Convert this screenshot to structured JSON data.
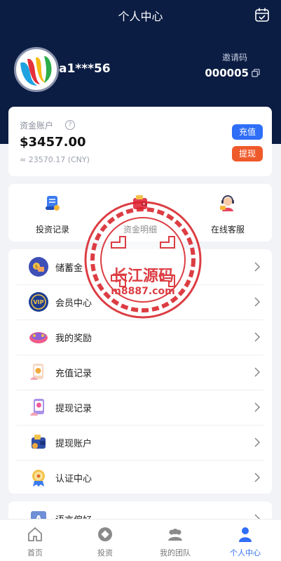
{
  "header": {
    "title": "个人中心"
  },
  "profile": {
    "username": "a1***56",
    "invite_label": "邀请码",
    "invite_code": "000005"
  },
  "account": {
    "label": "资金账户",
    "amount": "$3457.00",
    "cny": "≈ 23570.17 (CNY)",
    "recharge": "充值",
    "withdraw": "提现"
  },
  "quick": [
    {
      "label": "投资记录",
      "icon": "scroll-icon"
    },
    {
      "label": "资金明细",
      "icon": "wallet-icon"
    },
    {
      "label": "在线客服",
      "icon": "support-agent-icon"
    }
  ],
  "menu": [
    {
      "label": "储蓄金",
      "icon": "savings-icon"
    },
    {
      "label": "会员中心",
      "icon": "vip-icon"
    },
    {
      "label": "我的奖励",
      "icon": "reward-icon"
    },
    {
      "label": "充值记录",
      "icon": "recharge-record-icon"
    },
    {
      "label": "提现记录",
      "icon": "withdraw-record-icon"
    },
    {
      "label": "提现账户",
      "icon": "withdraw-account-icon"
    },
    {
      "label": "认证中心",
      "icon": "certification-icon"
    }
  ],
  "menu2": [
    {
      "label": "语言偏好",
      "icon": "language-icon"
    }
  ],
  "tabs": [
    {
      "label": "首页",
      "icon": "home-icon"
    },
    {
      "label": "投资",
      "icon": "invest-icon"
    },
    {
      "label": "我的团队",
      "icon": "team-icon"
    },
    {
      "label": "个人中心",
      "icon": "person-icon"
    }
  ],
  "watermark": {
    "line1": "长江源码",
    "line2": "m8887.com"
  },
  "colors": {
    "header_bg": "#0c1d43",
    "accent": "#2f6ef6",
    "withdraw": "#ef5a2b",
    "stamp": "#d8232a"
  }
}
